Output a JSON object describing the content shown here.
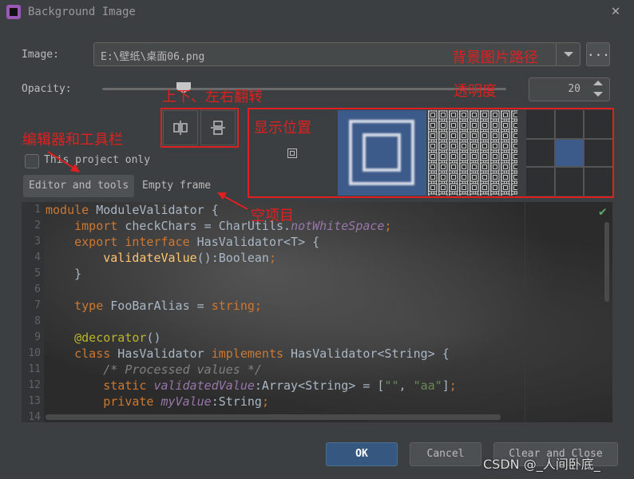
{
  "window": {
    "title": "Background Image"
  },
  "image_row": {
    "label": "Image:",
    "path": "E:\\壁纸\\桌面06.png",
    "browse_label": "..."
  },
  "opacity_row": {
    "label": "Opacity:",
    "value": "20",
    "slider_percent": 20
  },
  "project_only": {
    "label": "This project only",
    "checked": false
  },
  "targets": {
    "editor_tools": "Editor and tools",
    "empty_frame": "Empty frame",
    "selected": "Editor and tools"
  },
  "editor": {
    "lines": [
      {
        "n": "1",
        "text": "module ModuleValidator {"
      },
      {
        "n": "2",
        "text": "    import checkChars = CharUtils.notWhiteSpace;"
      },
      {
        "n": "3",
        "text": "    export interface HasValidator<T> {"
      },
      {
        "n": "4",
        "text": "        validateValue():Boolean;"
      },
      {
        "n": "5",
        "text": "    }"
      },
      {
        "n": "6",
        "text": ""
      },
      {
        "n": "7",
        "text": "    type FooBarAlias = string;"
      },
      {
        "n": "8",
        "text": ""
      },
      {
        "n": "9",
        "text": "    @decorator()"
      },
      {
        "n": "10",
        "text": "    class HasValidator implements HasValidator<String> {"
      },
      {
        "n": "11",
        "text": "        /* Processed values */"
      },
      {
        "n": "12",
        "text": "        static validatedValue:Array<String> = [\"\", \"aa\"];"
      },
      {
        "n": "13",
        "text": "        private myValue:String;"
      },
      {
        "n": "14",
        "text": ""
      }
    ]
  },
  "buttons": {
    "ok": "OK",
    "cancel": "Cancel",
    "clear_close": "Clear and Close"
  },
  "annotations": {
    "path": "背景图片路径",
    "opacity": "透明度",
    "flip": "上下、左右翻转",
    "position": "显示位置",
    "editor_tools": "编辑器和工具栏",
    "empty": "空项目"
  },
  "watermark": "CSDN @_人间卧底_",
  "colors": {
    "annotation_red": "#e02020",
    "accent_blue": "#365880",
    "check_green": "#59a869"
  }
}
